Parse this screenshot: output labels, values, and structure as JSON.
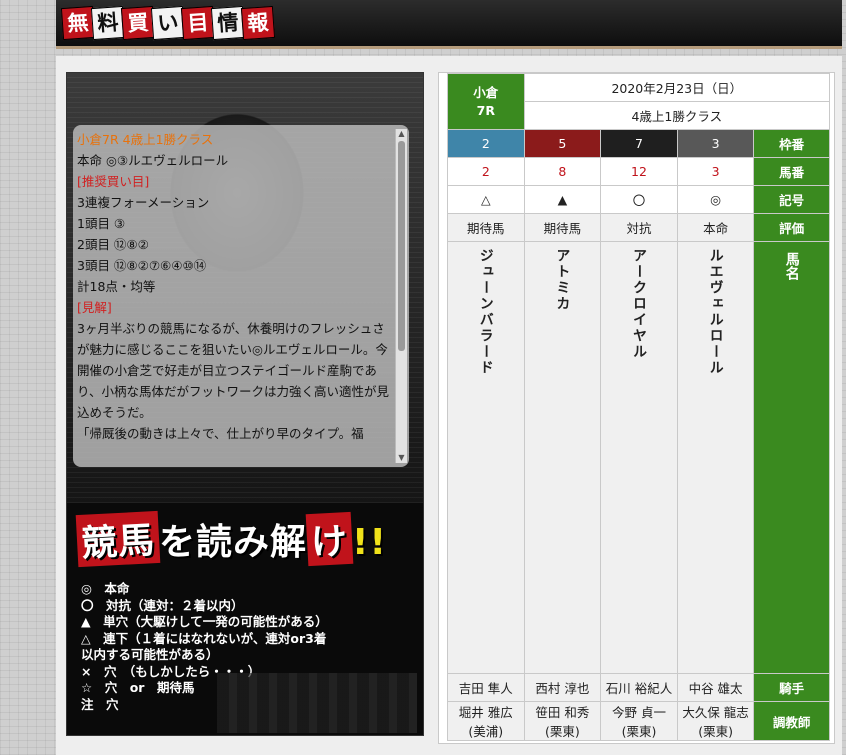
{
  "header": {
    "logo_chars": [
      "無",
      "料",
      "買",
      "い",
      "目",
      "情",
      "報"
    ]
  },
  "left_panel": {
    "text_lines": [
      {
        "text": "小倉7R 4歳上1勝クラス",
        "style": "orange"
      },
      {
        "text": "本命 ◎③ルエヴェルロール",
        "style": "normal"
      },
      {
        "text": "[推奨買い目]",
        "style": "red"
      },
      {
        "text": "3連複フォーメーション",
        "style": "normal"
      },
      {
        "text": "1頭目 ③",
        "style": "normal"
      },
      {
        "text": "2頭目 ⑫⑧②",
        "style": "normal"
      },
      {
        "text": "3頭目 ⑫⑧②⑦⑥④⑩⑭",
        "style": "normal"
      },
      {
        "text": "計18点・均等",
        "style": "normal"
      },
      {
        "text": " ",
        "style": "normal"
      },
      {
        "text": "[見解]",
        "style": "red"
      },
      {
        "text": "3ヶ月半ぶりの競馬になるが、休養明けのフレッシュさが魅力に感じるここを狙いたい◎ルエヴェルロール。今開催の小倉芝で好走が目立つステイゴールド産駒であり、小柄な馬体だがフットワークは力強く高い適性が見込めそうだ。",
        "style": "normal"
      },
      {
        "text": "「帰厩後の動きは上々で、仕上がり早のタイプ。福",
        "style": "normal"
      }
    ],
    "banner": {
      "part1": "競馬",
      "part2": "を読み解",
      "part3": "け",
      "part4": "!!"
    },
    "legend": [
      "◎　本命",
      "〇　対抗（連対：２着以内）",
      "▲　単穴（大駆けして一発の可能性がある）",
      "△　連下（１着にはなれないが、連対or3着",
      "以内する可能性がある）",
      "×　穴　（もしかしたら・・・）",
      "☆　穴　or　期待馬",
      "注　穴"
    ]
  },
  "race": {
    "venue": "小倉",
    "number": "7R",
    "date": "2020年2月23日（日）",
    "class": "4歳上1勝クラス"
  },
  "row_labels": {
    "waku": "枠番",
    "umaban": "馬番",
    "mark": "記号",
    "rating": "評価",
    "name": "馬名",
    "jockey": "騎手",
    "trainer": "調教師"
  },
  "horses": [
    {
      "waku": "2",
      "umaban": "2",
      "mark": "△",
      "rating": "期待馬",
      "name": "ジューンバラード",
      "jockey": "吉田 隼人",
      "trainer": "堀井 雅広",
      "stable": "(美浦)"
    },
    {
      "waku": "5",
      "umaban": "8",
      "mark": "▲",
      "rating": "期待馬",
      "name": "アトミカ",
      "jockey": "西村 淳也",
      "trainer": "笹田 和秀",
      "stable": "(栗東)"
    },
    {
      "waku": "7",
      "umaban": "12",
      "mark": "〇",
      "rating": "対抗",
      "name": "アークロイヤル",
      "jockey": "石川 裕紀人",
      "trainer": "今野 貞一",
      "stable": "(栗東)"
    },
    {
      "waku": "3",
      "umaban": "3",
      "mark": "◎",
      "rating": "本命",
      "name": "ルエヴェルロール",
      "jockey": "中谷 雄太",
      "trainer": "大久保 龍志",
      "stable": "(栗東)"
    }
  ],
  "colors": {
    "green": "#3a8a1f",
    "waku2": "#3f85a9",
    "waku5": "#8b1b1b",
    "waku7": "#1f1f1f",
    "waku3": "#585858",
    "red_text": "#c0131b",
    "orange_text": "#e8720c"
  }
}
